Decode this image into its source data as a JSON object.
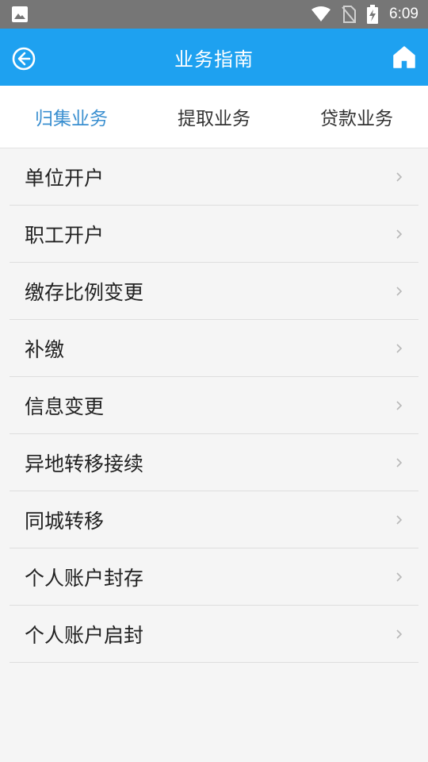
{
  "status_bar": {
    "time": "6:09",
    "icons": [
      "image-icon",
      "wifi-icon",
      "no-sim-icon",
      "battery-charging-icon"
    ]
  },
  "header": {
    "title": "业务指南",
    "back_icon": "back-circle-icon",
    "home_icon": "home-icon",
    "background_color": "#1ea1f0"
  },
  "tabs": [
    {
      "label": "归集业务",
      "active": true
    },
    {
      "label": "提取业务",
      "active": false
    },
    {
      "label": "贷款业务",
      "active": false
    }
  ],
  "colors": {
    "accent": "#1ea1f0",
    "active_tab": "#3a8fd0",
    "status_bar": "#767676"
  },
  "list": {
    "items": [
      {
        "label": "单位开户"
      },
      {
        "label": "职工开户"
      },
      {
        "label": "缴存比例变更"
      },
      {
        "label": "补缴"
      },
      {
        "label": "信息变更"
      },
      {
        "label": "异地转移接续"
      },
      {
        "label": "同城转移"
      },
      {
        "label": "个人账户封存"
      },
      {
        "label": "个人账户启封"
      }
    ]
  }
}
